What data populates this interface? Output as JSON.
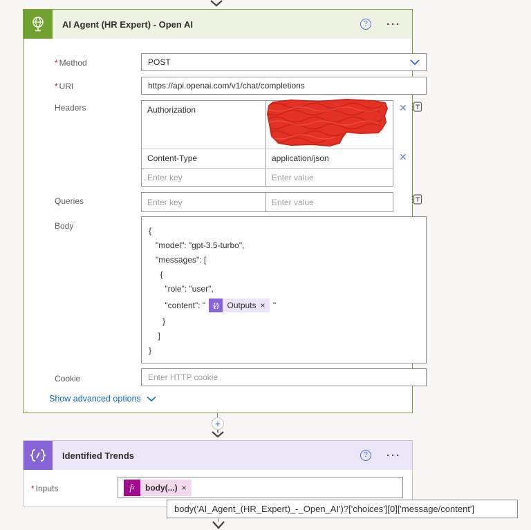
{
  "ui": {
    "required": "*",
    "help": "?",
    "menu": "···",
    "remove_x": "✕",
    "pill_x": "×",
    "plus": "+",
    "token_icon_glyph": "{∕}",
    "fx_glyph": "f"
  },
  "http_card": {
    "title": "AI Agent (HR Expert) - Open AI",
    "method": {
      "label": "Method",
      "value": "POST"
    },
    "uri": {
      "label": "URI",
      "value": "https://api.openai.com/v1/chat/completions"
    },
    "headers": {
      "label": "Headers",
      "rows": [
        {
          "key": "Authorization"
        },
        {
          "key": "Content-Type",
          "value": "application/json"
        }
      ],
      "key_placeholder": "Enter key",
      "value_placeholder": "Enter value"
    },
    "queries": {
      "label": "Queries",
      "key_placeholder": "Enter key",
      "value_placeholder": "Enter value"
    },
    "body": {
      "label": "Body",
      "lines": [
        "{",
        "   \"model\": \"gpt-3.5-turbo\",",
        "   \"messages\": [",
        "     {",
        "       \"role\": \"user\",",
        "",
        "      }",
        "    ]",
        "}"
      ],
      "content_prefix": "       \"content\": \" ",
      "token_label": "Outputs",
      "content_suffix": " \""
    },
    "cookie": {
      "label": "Cookie",
      "placeholder": "Enter HTTP cookie"
    },
    "advanced_link": "Show advanced options"
  },
  "compose_card": {
    "title": "Identified Trends",
    "inputs": {
      "label": "Inputs",
      "token_label": "body(...)"
    },
    "tooltip": "body('AI_Agent_(HR_Expert)_-_Open_AI')?['choices'][0]['message/content']"
  },
  "colors": {
    "http_green": "#6fa22e",
    "http_header_bg": "#edf2e3",
    "compose_purple": "#8764d8",
    "compose_header_bg": "#ece7f8",
    "expression_magenta": "#a30b8f",
    "link_blue": "#0f6cbd",
    "redaction_red": "#e33125"
  }
}
